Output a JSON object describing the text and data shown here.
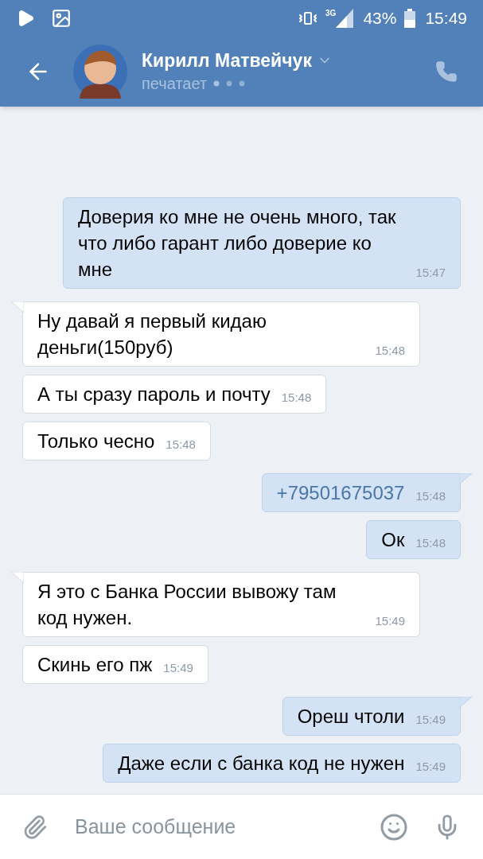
{
  "status_bar": {
    "network": "3G",
    "battery": "43%",
    "time": "15:49"
  },
  "header": {
    "name": "Кирилл Матвейчук",
    "status": "печатает"
  },
  "messages": [
    {
      "kind": "outgoing",
      "text": "Доверия ко мне не очень много, так что либо гарант либо доверие ко мне",
      "time": "15:47"
    },
    {
      "kind": "incoming",
      "text": "Ну давай я первый кидаю деньги(150руб)",
      "time": "15:48"
    },
    {
      "kind": "incoming",
      "text": "А ты сразу пароль и почту",
      "time": "15:48"
    },
    {
      "kind": "incoming",
      "text": "Только чесно",
      "time": "15:48"
    },
    {
      "kind": "outgoing",
      "text": "+79501675037",
      "time": "15:48",
      "link": true
    },
    {
      "kind": "outgoing",
      "text": "Ок",
      "time": "15:48"
    },
    {
      "kind": "incoming",
      "text": "Я это с Банка России вывожу там код нужен.",
      "time": "15:49"
    },
    {
      "kind": "incoming",
      "text": "Скинь его пж",
      "time": "15:49"
    },
    {
      "kind": "outgoing",
      "text": "Ореш чтоли",
      "time": "15:49"
    },
    {
      "kind": "outgoing",
      "text": "Даже если с банка код не нужен",
      "time": "15:49"
    }
  ],
  "composer": {
    "placeholder": "Ваше сообщение"
  }
}
